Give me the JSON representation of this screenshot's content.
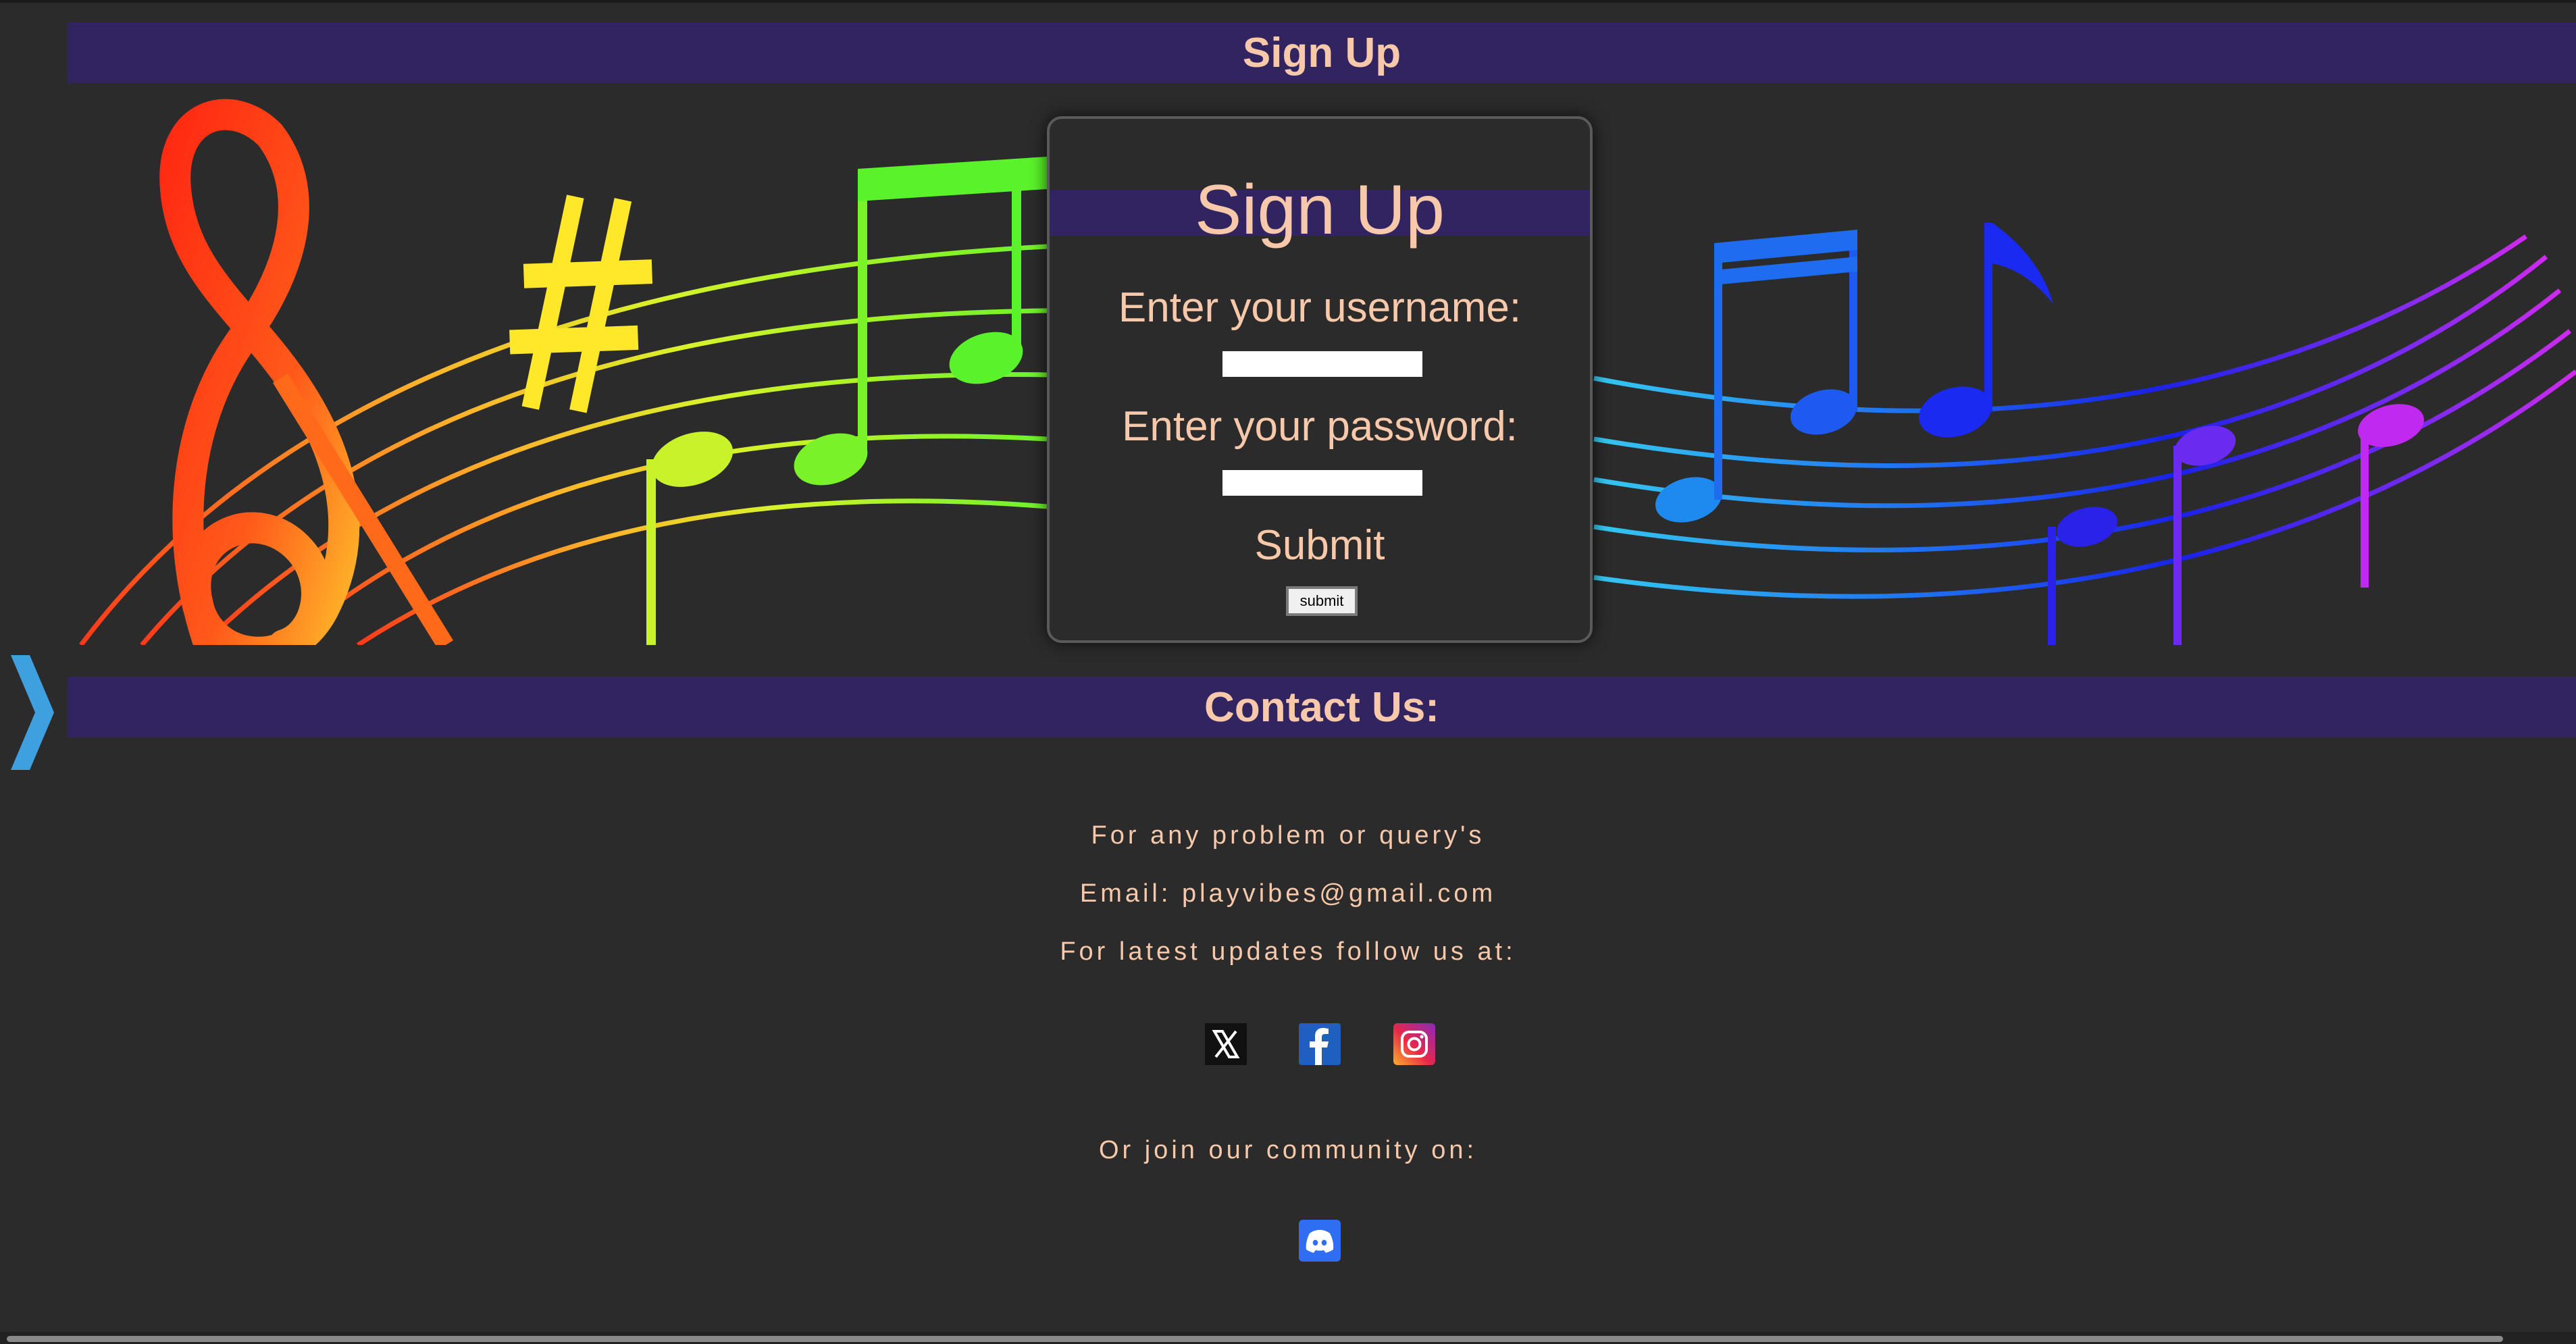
{
  "header": {
    "title": "Sign Up"
  },
  "signup_form": {
    "title": "Sign Up",
    "username_label": "Enter your username:",
    "username_value": "",
    "password_label": "Enter your password:",
    "password_value": "",
    "submit_heading": "Submit",
    "submit_button": "submit"
  },
  "contact": {
    "title": "Contact Us:",
    "line_problem": "For any problem or query's",
    "line_email": "Email: playvibes@gmail.com",
    "line_follow": "For latest updates follow us at:",
    "line_community": "Or join our community on:",
    "socials": [
      "x-icon",
      "facebook-icon",
      "instagram-icon"
    ],
    "community": [
      "discord-icon"
    ]
  },
  "banner": {
    "description_icon": "music-notes-rainbow-banner"
  },
  "nav": {
    "side_toggle_icon": "chevron-right-icon"
  },
  "colors": {
    "header_bar": "#322460",
    "text_accent": "#f7c8a9",
    "background": "#2b2b2b",
    "side_arrow": "#3fa0e0",
    "discord": "#5865f2",
    "facebook": "#1877f2"
  }
}
